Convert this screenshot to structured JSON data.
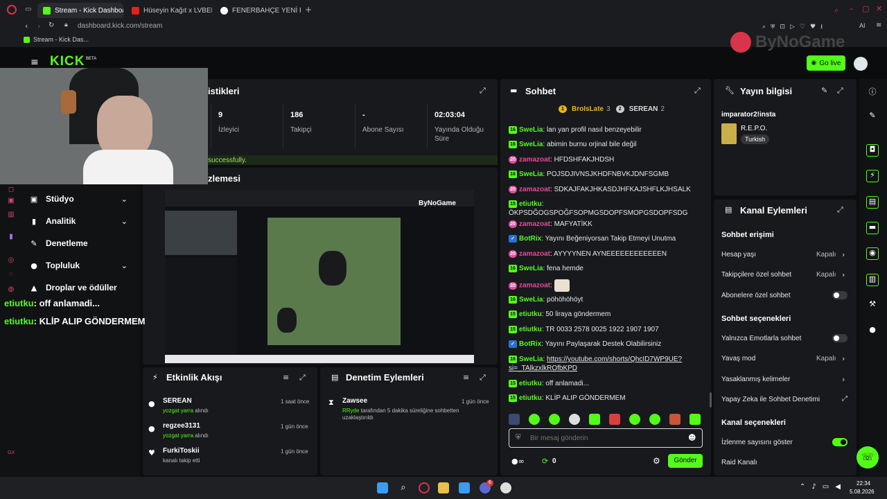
{
  "browser": {
    "tabs": [
      {
        "label": "Stream - Kick Dashboard"
      },
      {
        "label": "Hüseyin Kağıt x LVBEL C5"
      },
      {
        "label": "FENERBAHÇE YENİ FORMA"
      }
    ],
    "address": "dashboard.kick.com/stream",
    "bookmark": "Stream - Kick Das...",
    "ai_label": "AI"
  },
  "header": {
    "logo": "KICK",
    "logo_badge": "BETA",
    "golive_label": "Go live",
    "watermark": "ByNoGame"
  },
  "stats": {
    "title_fragment": "istikleri",
    "items": [
      {
        "value": "9",
        "label": "İzleyici"
      },
      {
        "value": "186",
        "label": "Takipçi"
      },
      {
        "value": "-",
        "label": "Abone Sayısı"
      },
      {
        "value": "02:03:04",
        "label": "Yayında Olduğu Süre"
      }
    ],
    "success_fragment": "successfully."
  },
  "preview": {
    "title_fragment": "zlemesi"
  },
  "sidebar": {
    "items": [
      {
        "label": "Stüdyo"
      },
      {
        "label": "Analitik"
      },
      {
        "label": "Denetleme"
      },
      {
        "label": "Topluluk"
      },
      {
        "label": "Droplar ve ödüller"
      }
    ]
  },
  "overlay_chat": [
    {
      "user": "etiutku",
      "msg": ": off anlamadi..."
    },
    {
      "user": "etiutku",
      "msg": ": KLİP ALIP GÖNDERMEM"
    }
  ],
  "activity": {
    "title": "Etkinlik Akışı",
    "items": [
      {
        "name": "SEREAN",
        "sub_user": "yozgat yarra",
        "sub_rest": " alındı",
        "time": "1 saat önce"
      },
      {
        "name": "regzee3131",
        "sub_user": "yozgat yarra",
        "sub_rest": " alındı",
        "time": "1 gün önce"
      },
      {
        "name": "FurkiToskii",
        "sub_user": "",
        "sub_rest": "kanalı takip etti",
        "time": "1 gün önce"
      }
    ]
  },
  "moderation": {
    "title": "Denetim Eylemleri",
    "items": [
      {
        "name": "Zawsee",
        "actor": "RRyde",
        "detail": " tarafından 5 dakika süreliğine sohbetten uzaklaştırıldı",
        "time": "1 gün önce"
      }
    ]
  },
  "chat": {
    "title": "Sohbet",
    "top": [
      {
        "rank": "1",
        "name": "BroIsLate",
        "count": "3"
      },
      {
        "rank": "2",
        "name": "SEREAN",
        "count": "2"
      }
    ],
    "messages": [
      {
        "badge": "16",
        "btype": "b16",
        "user": "SweLia",
        "ucolor": "u-green",
        "text": "lan yan profil nasıl benzeyebilir"
      },
      {
        "badge": "16",
        "btype": "b16",
        "user": "SweLia",
        "ucolor": "u-green",
        "text": "abimin burnu orjinal bile değil"
      },
      {
        "badge": "20",
        "btype": "bpink",
        "user": "zamazoat",
        "ucolor": "u-pink",
        "text": "HFDSHFAKJHDSH"
      },
      {
        "badge": "16",
        "btype": "b16",
        "user": "SweLia",
        "ucolor": "u-green",
        "text": "POJSDJIVNSJKHDFNBVKJDNFSGMB"
      },
      {
        "badge": "20",
        "btype": "bpink",
        "user": "zamazoat",
        "ucolor": "u-pink",
        "text": "SDKAJFAKJHKASDJHFKAJSHFLKJHSALK"
      },
      {
        "badge": "15",
        "btype": "b16",
        "user": "etiutku",
        "ucolor": "u-green",
        "text": "ÖKPSDĞOGSPOĞFSOPMGSDOPFSMOPGSDOPFSDG"
      },
      {
        "badge": "20",
        "btype": "bpink",
        "user": "zamazoat",
        "ucolor": "u-pink",
        "text": "MAFYATİKK"
      },
      {
        "badge": "✓",
        "btype": "bblue",
        "user": "BotRix",
        "ucolor": "u-green",
        "text": "Yayını Beğeniyorsan Takip Etmeyi Unutma"
      },
      {
        "badge": "20",
        "btype": "bpink",
        "user": "zamazoat",
        "ucolor": "u-pink",
        "text": "AYYYYNEN AYNEEEEEEEEEEEEN"
      },
      {
        "badge": "16",
        "btype": "b16",
        "user": "SweLia",
        "ucolor": "u-green",
        "text": "fena hemde"
      },
      {
        "badge": "20",
        "btype": "bpink",
        "user": "zamazoat",
        "ucolor": "u-pink",
        "text": ""
      },
      {
        "badge": "16",
        "btype": "b16",
        "user": "SweLia",
        "ucolor": "u-green",
        "text": "pöhöhöhöyt"
      },
      {
        "badge": "15",
        "btype": "b16",
        "user": "etiutku",
        "ucolor": "u-green",
        "text": "50 liraya göndermem"
      },
      {
        "badge": "15",
        "btype": "b16",
        "user": "etiutku",
        "ucolor": "u-green",
        "text": "TR 0033 2578 0025 1922 1907 1907"
      },
      {
        "badge": "✓",
        "btype": "bblue",
        "user": "BotRix",
        "ucolor": "u-green",
        "text": "Yayını Paylaşarak Destek Olabilirsiniz"
      },
      {
        "badge": "16",
        "btype": "b16",
        "user": "SweLia",
        "ucolor": "u-green",
        "text": "https://youtube.com/shorts/QhcID7WP9UE?si=_TAlkzxlkROfbKPD",
        "is_link": true
      },
      {
        "badge": "15",
        "btype": "b16",
        "user": "etiutku",
        "ucolor": "u-green",
        "text": "off anlamadi..."
      },
      {
        "badge": "15",
        "btype": "b16",
        "user": "etiutku",
        "ucolor": "u-green",
        "text": "KLİP ALIP GÖNDERMEM"
      }
    ],
    "input_placeholder": "Bir mesaj gönderin",
    "points": "0",
    "send_label": "Gönder"
  },
  "stream_info": {
    "title": "Yayın bilgisi",
    "stream_title": "imparator2!insta",
    "category": "R.E.P.O.",
    "language": "Turkish"
  },
  "channel_actions": {
    "title": "Kanal Eylemleri",
    "chat_access_head": "Sohbet erişimi",
    "account_age_label": "Hesap yaşı",
    "account_age_value": "Kapalı",
    "followers_label": "Takipçilere özel sohbet",
    "followers_value": "Kapalı",
    "subs_label": "Abonelere özel sohbet",
    "chat_options_head": "Sohbet seçenekleri",
    "emotes_label": "Yalnızca Emotlarla sohbet",
    "slow_label": "Yavaş mod",
    "slow_value": "Kapalı",
    "banned_words_label": "Yasaklanmış kelimeler",
    "ai_mod_label": "Yapay Zeka ile Sohbet Denetimi",
    "channel_options_head": "Kanal seçenekleri",
    "viewcount_label": "İzlenme sayısını göster",
    "raid_label": "Raid Kanalı",
    "toggles": {
      "subs": false,
      "emotes": false,
      "viewcount": true
    }
  },
  "taskbar": {
    "time": "22:34",
    "date": "5.08.2026",
    "notif_count": "6"
  },
  "colors": {
    "accent": "#53fc18",
    "pink": "#e24c9b",
    "panel": "#18191c",
    "bg": "#0c0d0f"
  }
}
